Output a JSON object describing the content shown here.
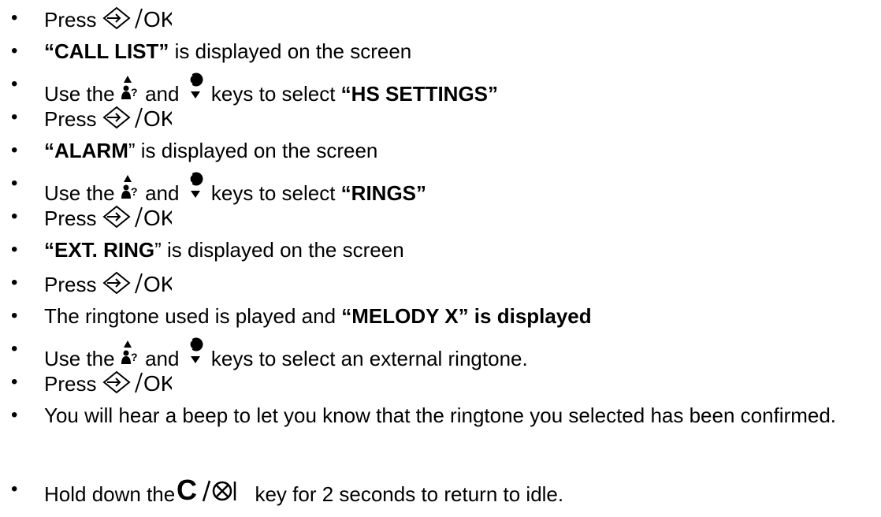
{
  "bullet": "•",
  "keys": {
    "ok_label": "OK",
    "clear_label": "C",
    "and": "and",
    "nav_up_glyph": "?"
  },
  "steps": [
    {
      "id": 1,
      "prefix": "Press",
      "key": "ok"
    },
    {
      "id": 2,
      "bold": "“CALL LIST”",
      "suffix": " is displayed on the screen"
    },
    {
      "id": 3,
      "prefix": "Use the",
      "mid": " keys to select ",
      "bold": "“HS SETTINGS”"
    },
    {
      "id": 4,
      "prefix": "Press",
      "key": "ok"
    },
    {
      "id": 5,
      "bold": "“ALARM",
      "suffix": "” is displayed on the screen"
    },
    {
      "id": 6,
      "prefix": "Use the",
      "mid": " keys to select ",
      "bold": "“RINGS”"
    },
    {
      "id": 7,
      "prefix": "Press",
      "key": "ok"
    },
    {
      "id": 8,
      "bold": "“EXT. RING",
      "suffix": "” is displayed on the screen"
    },
    {
      "id": 9,
      "prefix": "Press",
      "key": "ok"
    },
    {
      "id": 10,
      "prefix": "The ringtone used is played and ",
      "bold": "“MELODY X” is displayed"
    },
    {
      "id": 11,
      "prefix": "Use the",
      "mid": " keys to select an external ringtone."
    },
    {
      "id": 12,
      "prefix": "Press",
      "key": "ok"
    },
    {
      "id": 13,
      "text": "You will hear a beep to let you know that the ringtone you selected has been confirmed."
    },
    {
      "id": 14,
      "prefix": "Hold down the",
      "suffix": " key for 2 seconds to return to idle."
    }
  ]
}
